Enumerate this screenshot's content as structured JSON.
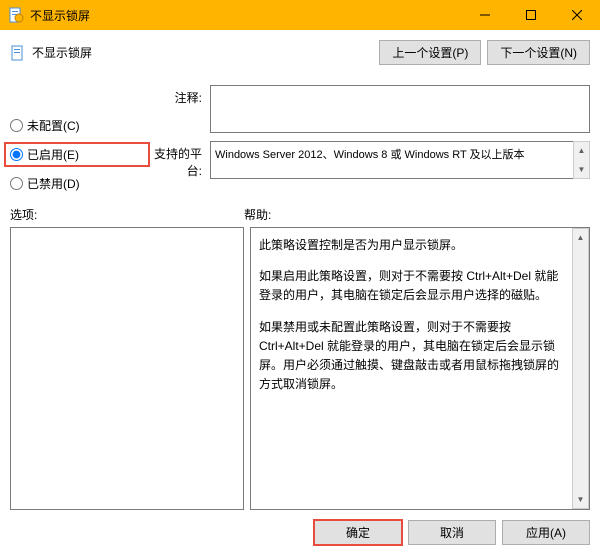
{
  "window": {
    "title": "不显示锁屏"
  },
  "header": {
    "title": "不显示锁屏",
    "prev_btn": "上一个设置(P)",
    "next_btn": "下一个设置(N)"
  },
  "radios": {
    "not_configured": "未配置(C)",
    "enabled": "已启用(E)",
    "disabled": "已禁用(D)"
  },
  "fields": {
    "comment_label": "注释:",
    "comment_value": "",
    "platform_label": "支持的平台:",
    "platform_value": "Windows Server 2012、Windows 8 或 Windows RT 及以上版本"
  },
  "labels": {
    "options": "选项:",
    "help": "帮助:"
  },
  "help": {
    "p1": "此策略设置控制是否为用户显示锁屏。",
    "p2": "如果启用此策略设置，则对于不需要按 Ctrl+Alt+Del 就能登录的用户，其电脑在锁定后会显示用户选择的磁贴。",
    "p3": "如果禁用或未配置此策略设置，则对于不需要按 Ctrl+Alt+Del 就能登录的用户，其电脑在锁定后会显示锁屏。用户必须通过触摸、键盘敲击或者用鼠标拖拽锁屏的方式取消锁屏。"
  },
  "footer": {
    "ok": "确定",
    "cancel": "取消",
    "apply": "应用(A)"
  }
}
